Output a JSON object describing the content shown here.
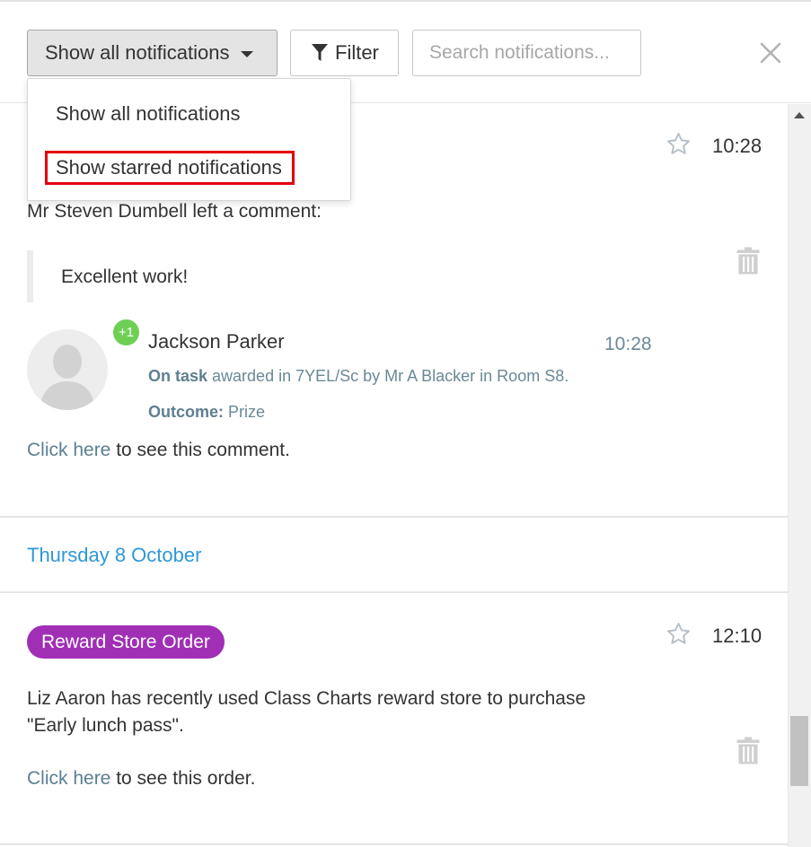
{
  "toolbar": {
    "show_label": "Show all notifications",
    "filter_label": "Filter",
    "search_placeholder": "Search notifications..."
  },
  "dropdown": {
    "items": [
      "Show all notifications",
      "Show starred notifications"
    ]
  },
  "notifications": [
    {
      "time": "10:28",
      "body": "Mr Steven Dumbell left a comment:",
      "quote": "Excellent work!",
      "award": {
        "badge": "+1",
        "student": "Jackson Parker",
        "time": "10:28",
        "behaviour": "On task",
        "detail": " awarded in 7YEL/Sc by Mr A Blacker in Room S8.",
        "outcome_label": "Outcome:",
        "outcome_value": " Prize"
      },
      "link_text": "Click here",
      "link_suffix": " to see this comment."
    },
    {
      "tag": "Reward Store Order",
      "time": "12:10",
      "body_line1": "Liz Aaron has recently used Class Charts reward store to purchase",
      "body_line2": "\"Early lunch pass\".",
      "link_text": "Click here",
      "link_suffix": " to see this order."
    }
  ],
  "date_header": "Thursday 8 October",
  "colors": {
    "accent_blue": "#2e98d8",
    "tag_purple": "#a02fb6",
    "badge_green": "#6fcf55",
    "highlight_red": "#e4000b"
  },
  "icons": [
    "filter-icon",
    "close-icon",
    "star-icon",
    "trash-icon",
    "avatar-placeholder-icon",
    "caret-down-icon",
    "scroll-up-arrow-icon"
  ]
}
